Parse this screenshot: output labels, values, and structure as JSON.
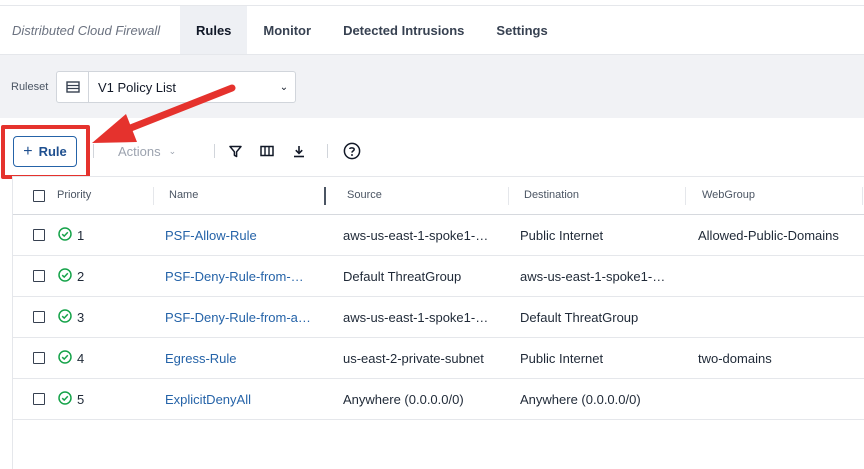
{
  "app_title": "Distributed Cloud Firewall",
  "tabs": [
    {
      "label": "Rules",
      "active": true
    },
    {
      "label": "Monitor",
      "active": false
    },
    {
      "label": "Detected Intrusions",
      "active": false
    },
    {
      "label": "Settings",
      "active": false
    }
  ],
  "ruleset": {
    "label": "Ruleset",
    "selected": "V1 Policy List"
  },
  "toolbar": {
    "add_rule_label": "Rule",
    "actions_label": "Actions"
  },
  "table": {
    "columns": [
      "Priority",
      "Name",
      "Source",
      "Destination",
      "WebGroup"
    ],
    "rows": [
      {
        "priority": "1",
        "name": "PSF-Allow-Rule",
        "source": "aws-us-east-1-spoke1-…",
        "destination": "Public Internet",
        "webgroup": "Allowed-Public-Domains"
      },
      {
        "priority": "2",
        "name": "PSF-Deny-Rule-from-…",
        "source": "Default ThreatGroup",
        "destination": "aws-us-east-1-spoke1-…",
        "webgroup": ""
      },
      {
        "priority": "3",
        "name": "PSF-Deny-Rule-from-a…",
        "source": "aws-us-east-1-spoke1-…",
        "destination": "Default ThreatGroup",
        "webgroup": ""
      },
      {
        "priority": "4",
        "name": "Egress-Rule",
        "source": "us-east-2-private-subnet",
        "destination": "Public Internet",
        "webgroup": "two-domains"
      },
      {
        "priority": "5",
        "name": "ExplicitDenyAll",
        "source": "Anywhere (0.0.0.0/0)",
        "destination": "Anywhere (0.0.0.0/0)",
        "webgroup": ""
      }
    ]
  },
  "colors": {
    "accent": "#2563a8",
    "highlight": "#e5322d",
    "status_ok": "#16a34a"
  }
}
